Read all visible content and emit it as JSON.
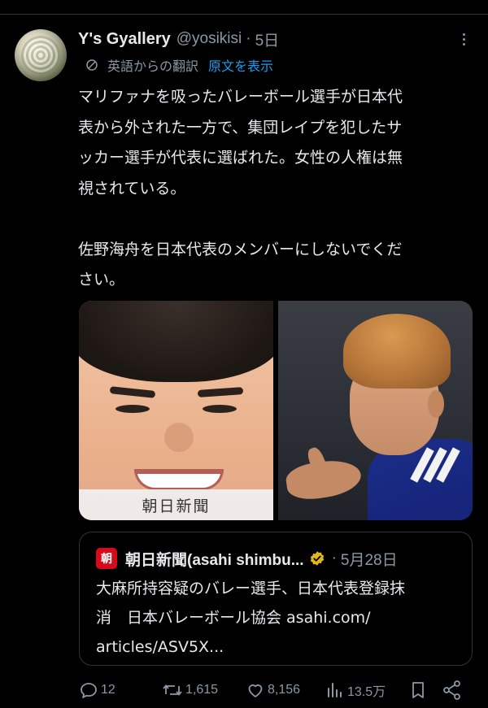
{
  "post": {
    "display_name": "Y's Gyallery",
    "handle": "@yosikisi",
    "dot": "·",
    "time": "5日",
    "translation": {
      "label": "英語からの翻訳",
      "show_original": "原文を表示"
    },
    "text_lines": [
      "マリファナを吸ったバレーボール選手が日本代",
      "表から外された一方で、集団レイプを犯したサ",
      "ッカー選手が代表に選ばれた。女性の人権は無",
      "視されている。",
      "",
      "佐野海舟を日本代表のメンバーにしないでくだ",
      "さい。"
    ]
  },
  "media": {
    "left_watermark": "朝日新聞"
  },
  "quote": {
    "logo_char": "朝",
    "name": "朝日新聞(asahi shimbu...",
    "dot": "·",
    "time": "5月28日",
    "text_lines": [
      "大麻所持容疑のバレー選手、日本代表登録抹",
      "消　日本バレーボール協会 asahi.com/",
      "articles/ASV5X..."
    ]
  },
  "actions": {
    "replies": "12",
    "reposts": "1,615",
    "likes": "8,156",
    "views": "13.5万"
  },
  "colors": {
    "background": "#000000",
    "text": "#e7e9ea",
    "muted": "#8b98a5",
    "link": "#1d9bf0",
    "border": "#2f3336",
    "asahi_red": "#d60a1b",
    "verified_gold": "#e2b719"
  },
  "icons": {
    "translate": "translate-icon",
    "more": "more-icon",
    "verified": "verified-badge-icon",
    "reply": "reply-icon",
    "repost": "repost-icon",
    "like": "like-icon",
    "views": "views-icon",
    "bookmark": "bookmark-icon",
    "share": "share-icon"
  }
}
